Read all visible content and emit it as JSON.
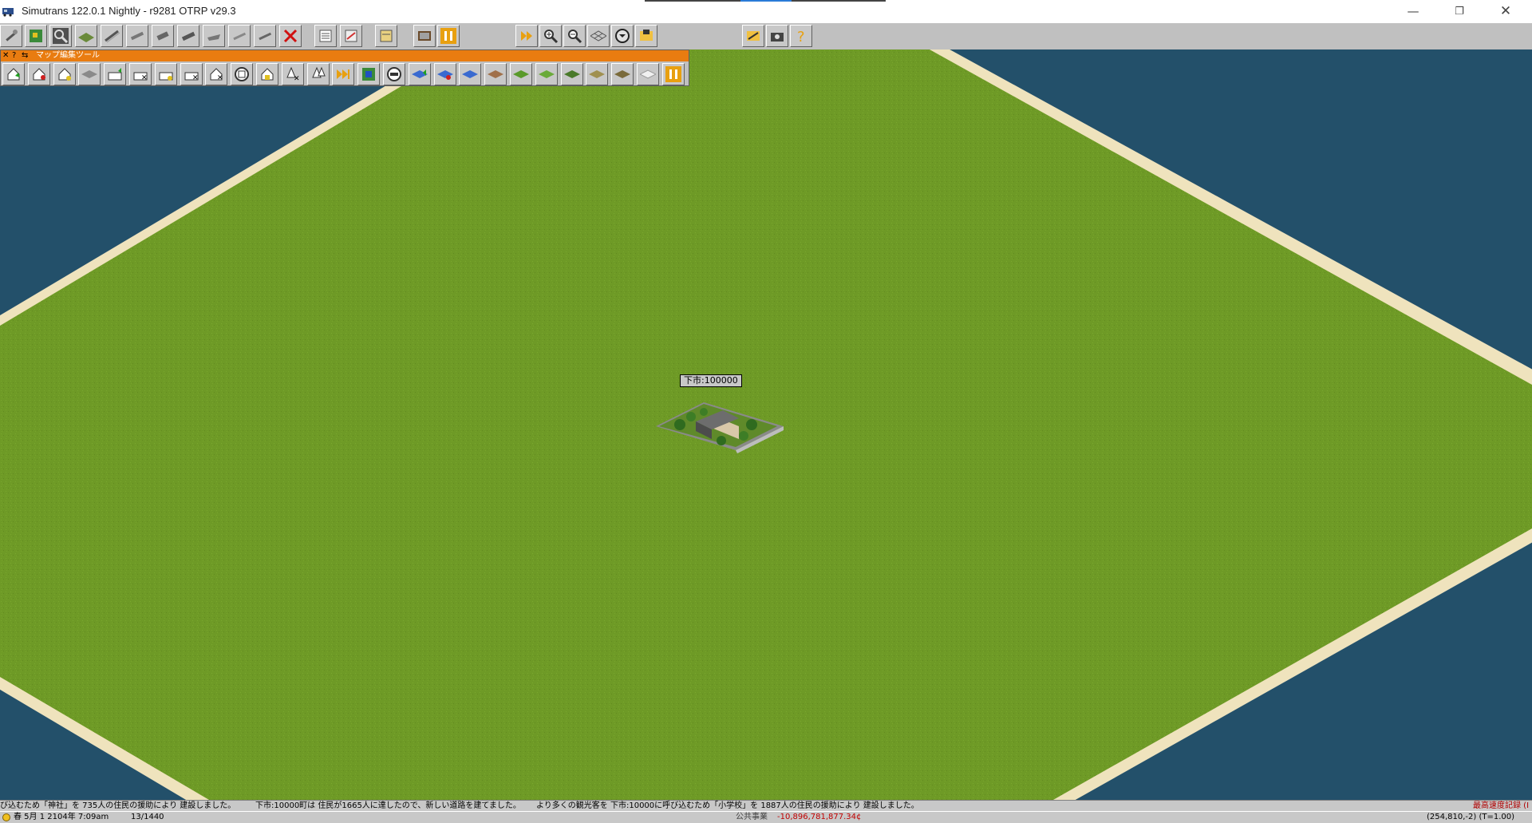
{
  "window": {
    "title": "Simutrans 122.0.1 Nightly - r9281  OTRP v29.3",
    "minimize_glyph": "—",
    "restore_glyph": "❐",
    "close_glyph": "✕"
  },
  "toolbar": {
    "items": [
      {
        "name": "tool-general",
        "icon": "wrench-icon"
      },
      {
        "name": "tool-map-edit",
        "icon": "map-edit-icon"
      },
      {
        "name": "tool-inspect",
        "icon": "magnifier-icon"
      },
      {
        "name": "tool-terrain",
        "icon": "terrain-slope-icon"
      },
      {
        "name": "tool-railway",
        "icon": "rail-icon"
      },
      {
        "name": "tool-monorail",
        "icon": "monorail-icon"
      },
      {
        "name": "tool-tram",
        "icon": "tram-icon"
      },
      {
        "name": "tool-road",
        "icon": "road-icon"
      },
      {
        "name": "tool-ship",
        "icon": "ship-icon"
      },
      {
        "name": "tool-airport",
        "icon": "airport-icon"
      },
      {
        "name": "tool-special",
        "icon": "special-construction-icon"
      },
      {
        "name": "tool-remove",
        "icon": "remove-icon"
      },
      {
        "name": "tool-list",
        "icon": "list-icon"
      },
      {
        "name": "tool-finance",
        "icon": "finance-icon"
      },
      {
        "name": "tool-schedule",
        "icon": "schedule-icon"
      },
      {
        "name": "tool-depot",
        "icon": "depot-icon"
      },
      {
        "name": "tool-pause",
        "icon": "pause-icon"
      },
      {
        "name": "tool-fast-forward",
        "icon": "fast-forward-icon"
      },
      {
        "name": "tool-zoom-in",
        "icon": "zoom-in-icon"
      },
      {
        "name": "tool-zoom-out",
        "icon": "zoom-out-icon"
      },
      {
        "name": "tool-grid",
        "icon": "grid-icon"
      },
      {
        "name": "tool-rotate",
        "icon": "rotate-icon"
      },
      {
        "name": "tool-save",
        "icon": "save-icon"
      },
      {
        "name": "tool-load",
        "icon": "load-icon"
      },
      {
        "name": "tool-screenshot",
        "icon": "camera-icon"
      },
      {
        "name": "tool-help",
        "icon": "help-icon"
      }
    ]
  },
  "palette": {
    "title": "マップ編集ツール",
    "ctrl_close": "✕",
    "ctrl_help": "?",
    "ctrl_pin": "⇆",
    "items": [
      {
        "name": "edit-build-town",
        "icon": "house-plus-icon"
      },
      {
        "name": "edit-remove-town",
        "icon": "house-remove-icon"
      },
      {
        "name": "edit-house",
        "icon": "house-icon"
      },
      {
        "name": "edit-land",
        "icon": "land-icon"
      },
      {
        "name": "edit-factory",
        "icon": "factory-icon"
      },
      {
        "name": "edit-factory-remove",
        "icon": "factory-remove-icon"
      },
      {
        "name": "edit-factory-chain",
        "icon": "factory-chain-icon"
      },
      {
        "name": "edit-factory-link",
        "icon": "factory-link-icon"
      },
      {
        "name": "edit-attraction",
        "icon": "attraction-icon"
      },
      {
        "name": "edit-monument",
        "icon": "monument-icon"
      },
      {
        "name": "edit-headquarters",
        "icon": "headquarters-icon"
      },
      {
        "name": "edit-tree-remove",
        "icon": "tree-remove-icon"
      },
      {
        "name": "edit-tree-plant",
        "icon": "tree-plant-icon"
      },
      {
        "name": "edit-skip",
        "icon": "skip-forward-icon"
      },
      {
        "name": "edit-map-color",
        "icon": "map-color-icon"
      },
      {
        "name": "edit-stop",
        "icon": "stop-icon"
      },
      {
        "name": "edit-raise-water",
        "icon": "water-raise-icon"
      },
      {
        "name": "edit-lower-water",
        "icon": "water-lower-icon"
      },
      {
        "name": "edit-water",
        "icon": "water-icon"
      },
      {
        "name": "edit-climate-desert",
        "icon": "climate-desert-icon"
      },
      {
        "name": "edit-climate-grass",
        "icon": "climate-grass-icon"
      },
      {
        "name": "edit-climate-meadow",
        "icon": "climate-meadow-icon"
      },
      {
        "name": "edit-climate-forest",
        "icon": "climate-forest-icon"
      },
      {
        "name": "edit-climate-steppe",
        "icon": "climate-steppe-icon"
      },
      {
        "name": "edit-climate-mud",
        "icon": "climate-mud-icon"
      },
      {
        "name": "edit-climate-snow",
        "icon": "climate-snow-icon"
      },
      {
        "name": "edit-pause",
        "icon": "pause-icon"
      }
    ]
  },
  "map": {
    "city_label": "下市:100000",
    "colors": {
      "grass": "#6e9a26",
      "beach": "#efe3bd",
      "water": "#23506a"
    }
  },
  "ticker": {
    "messages": [
      "び込むため「神社」を 735人の住民の援助により 建設しました。",
      "下市:10000町は 住民が1665人に達したので、新しい道路を建てました。",
      "より多くの観光客を 下市:10000に呼び込むため「小学校」を 1887人の住民の援助により 建設しました。"
    ],
    "record": "最高速度記録 (I"
  },
  "status": {
    "date": "春 5月 1 2104年  7:09am",
    "ratio": "13/1440",
    "player": "公共事業",
    "money": "-10,896,781,877.34¢",
    "coords": "(254,810,-2) (T=1.00)"
  }
}
